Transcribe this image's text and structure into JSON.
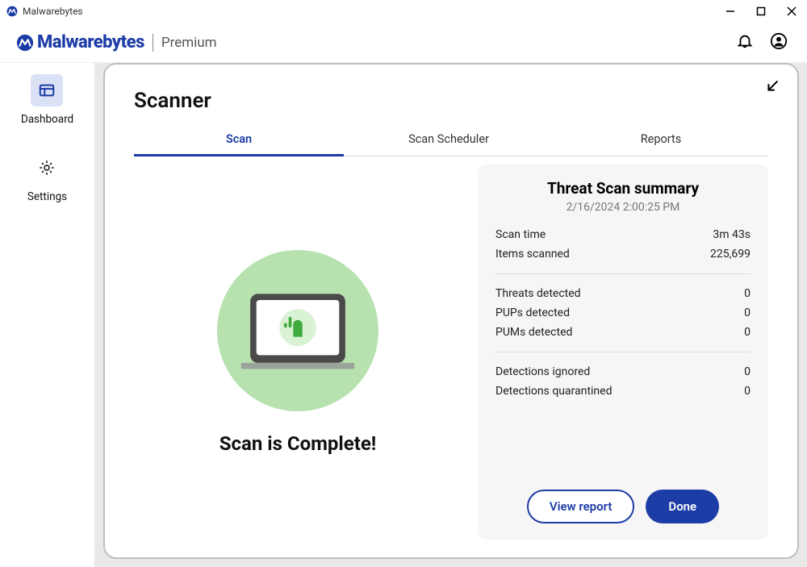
{
  "titlebar": {
    "title": "Malwarebytes"
  },
  "header": {
    "brand": "Malwarebytes",
    "tier": "Premium"
  },
  "sidebar": {
    "items": [
      {
        "label": "Dashboard",
        "active": true
      },
      {
        "label": "Settings",
        "active": false
      }
    ]
  },
  "panel": {
    "title": "Scanner",
    "tabs": [
      {
        "label": "Scan",
        "active": true
      },
      {
        "label": "Scan Scheduler",
        "active": false
      },
      {
        "label": "Reports",
        "active": false
      }
    ],
    "complete_text": "Scan is Complete!"
  },
  "summary": {
    "title": "Threat Scan summary",
    "timestamp": "2/16/2024 2:00:25 PM",
    "stats_group1": [
      {
        "label": "Scan time",
        "value": "3m 43s"
      },
      {
        "label": "Items scanned",
        "value": "225,699"
      }
    ],
    "stats_group2": [
      {
        "label": "Threats detected",
        "value": "0"
      },
      {
        "label": "PUPs detected",
        "value": "0"
      },
      {
        "label": "PUMs detected",
        "value": "0"
      }
    ],
    "stats_group3": [
      {
        "label": "Detections ignored",
        "value": "0"
      },
      {
        "label": "Detections quarantined",
        "value": "0"
      }
    ],
    "actions": {
      "view_report": "View report",
      "done": "Done"
    }
  }
}
